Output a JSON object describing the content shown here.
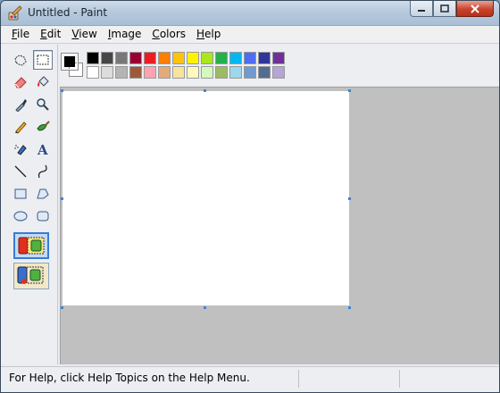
{
  "window": {
    "title": "Untitled - Paint"
  },
  "menu": {
    "items": [
      {
        "label": "File",
        "accel": "F",
        "rest": "ile"
      },
      {
        "label": "Edit",
        "accel": "E",
        "rest": "dit"
      },
      {
        "label": "View",
        "accel": "V",
        "rest": "iew"
      },
      {
        "label": "Image",
        "accel": "I",
        "rest": "mage"
      },
      {
        "label": "Colors",
        "accel": "C",
        "rest": "olors"
      },
      {
        "label": "Help",
        "accel": "H",
        "rest": "elp"
      }
    ]
  },
  "tools": [
    "free-form-select-icon",
    "rect-select-icon",
    "eraser-icon",
    "fill-bucket-icon",
    "color-picker-icon",
    "magnifier-icon",
    "pencil-icon",
    "brush-icon",
    "airbrush-icon",
    "text-icon",
    "line-icon",
    "curve-icon",
    "rectangle-icon",
    "polygon-icon",
    "ellipse-icon",
    "rounded-rect-icon"
  ],
  "palette": {
    "foreground": "#000000",
    "background": "#ffffff",
    "row1": [
      "#000000",
      "#464646",
      "#787878",
      "#990030",
      "#ed1c24",
      "#ff7e00",
      "#ffc20e",
      "#fff200",
      "#a8e61d",
      "#22b14c",
      "#00b7ef",
      "#4d6df3",
      "#2f3699",
      "#6f3198"
    ],
    "row2": [
      "#ffffff",
      "#dcdcdc",
      "#b4b4b4",
      "#9c5a3c",
      "#ffa3b1",
      "#e5aa7a",
      "#f5e49c",
      "#fff9bd",
      "#d3f9bc",
      "#9dbb61",
      "#99d9ea",
      "#709ad1",
      "#546d8e",
      "#b5a5d5"
    ]
  },
  "status": {
    "help": "For Help, click Help Topics on the Help Menu."
  }
}
